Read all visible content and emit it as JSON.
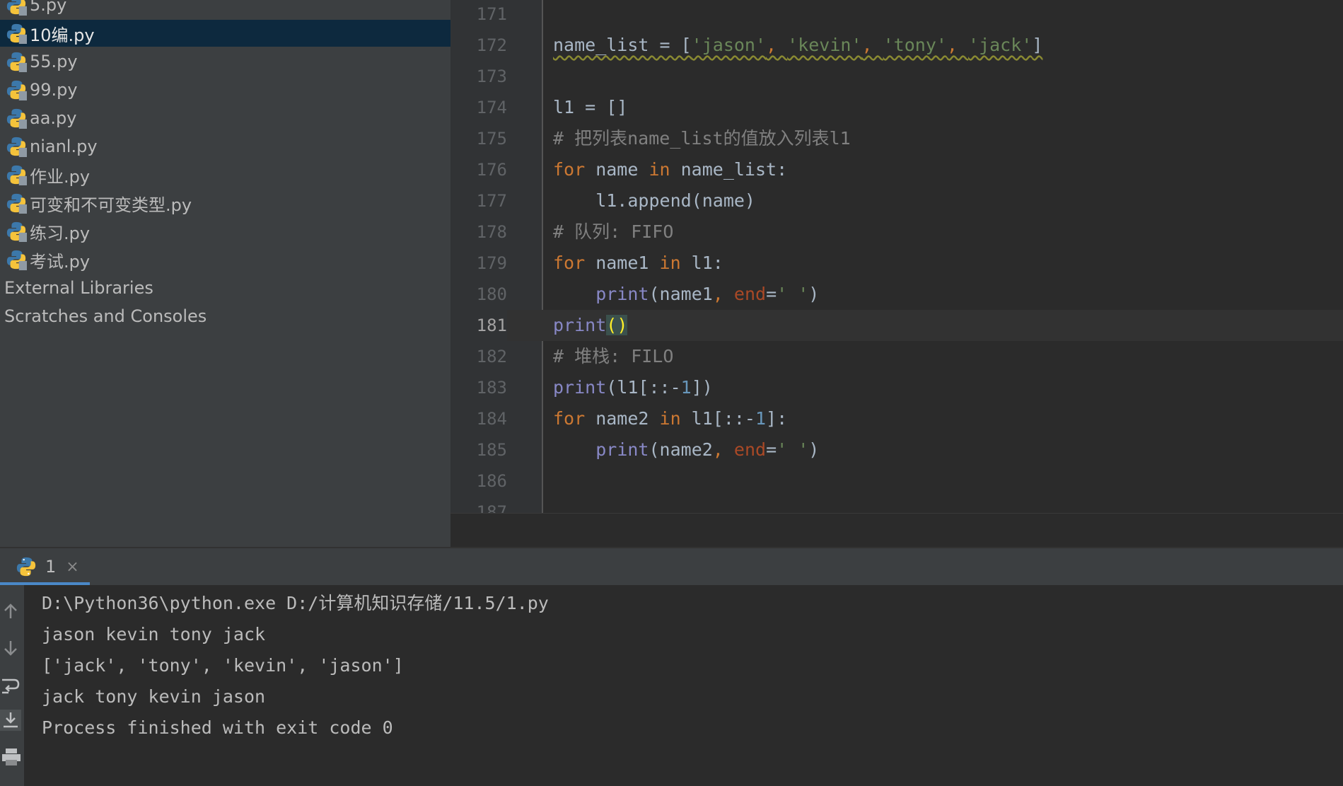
{
  "project_tree": {
    "files": [
      {
        "name": "5.py"
      },
      {
        "name": "10编.py",
        "selected": true
      },
      {
        "name": "55.py"
      },
      {
        "name": "99.py"
      },
      {
        "name": "aa.py"
      },
      {
        "name": "nianl.py"
      },
      {
        "name": "作业.py"
      },
      {
        "name": "可变和不可变类型.py"
      },
      {
        "name": "练习.py"
      },
      {
        "name": "考试.py"
      }
    ],
    "groups": [
      {
        "name": "External Libraries"
      },
      {
        "name": "Scratches and Consoles"
      }
    ]
  },
  "editor": {
    "current_line": "181",
    "lines": [
      {
        "num": "171",
        "tokens": []
      },
      {
        "num": "172",
        "tokens": [
          {
            "t": "name_list = [",
            "c": "ident"
          },
          {
            "t": "'jason'",
            "c": "str"
          },
          {
            "t": ", ",
            "c": "punct"
          },
          {
            "t": "'kevin'",
            "c": "str"
          },
          {
            "t": ", ",
            "c": "punct"
          },
          {
            "t": "'tony'",
            "c": "str"
          },
          {
            "t": ", ",
            "c": "punct"
          },
          {
            "t": "'jack'",
            "c": "str"
          },
          {
            "t": "]",
            "c": "ident"
          }
        ],
        "squiggle": true
      },
      {
        "num": "173",
        "tokens": []
      },
      {
        "num": "174",
        "tokens": [
          {
            "t": "l1 = []",
            "c": "ident"
          }
        ]
      },
      {
        "num": "175",
        "tokens": [
          {
            "t": "# 把列表name_list的值放入列表l1",
            "c": "comment"
          }
        ]
      },
      {
        "num": "176",
        "tokens": [
          {
            "t": "for",
            "c": "kw"
          },
          {
            "t": " name ",
            "c": "ident"
          },
          {
            "t": "in",
            "c": "kw"
          },
          {
            "t": " name_list:",
            "c": "ident"
          }
        ]
      },
      {
        "num": "177",
        "tokens": [
          {
            "t": "    l1.append(name)",
            "c": "ident"
          }
        ]
      },
      {
        "num": "178",
        "tokens": [
          {
            "t": "# 队列: FIFO",
            "c": "comment"
          }
        ]
      },
      {
        "num": "179",
        "tokens": [
          {
            "t": "for",
            "c": "kw"
          },
          {
            "t": " name1 ",
            "c": "ident"
          },
          {
            "t": "in",
            "c": "kw"
          },
          {
            "t": " l1:",
            "c": "ident"
          }
        ]
      },
      {
        "num": "180",
        "tokens": [
          {
            "t": "    ",
            "c": "ident"
          },
          {
            "t": "print",
            "c": "bi"
          },
          {
            "t": "(name1",
            "c": "ident"
          },
          {
            "t": ", ",
            "c": "punct"
          },
          {
            "t": "end",
            "c": "param"
          },
          {
            "t": "=",
            "c": "ident"
          },
          {
            "t": "' '",
            "c": "str"
          },
          {
            "t": ")",
            "c": "ident"
          }
        ]
      },
      {
        "num": "181",
        "tokens": [
          {
            "t": "print",
            "c": "bi"
          },
          {
            "t": "()",
            "c": "matched"
          }
        ]
      },
      {
        "num": "182",
        "tokens": [
          {
            "t": "# 堆栈: FILO",
            "c": "comment"
          }
        ]
      },
      {
        "num": "183",
        "tokens": [
          {
            "t": "print",
            "c": "bi"
          },
          {
            "t": "(l1[::-",
            "c": "ident"
          },
          {
            "t": "1",
            "c": "num"
          },
          {
            "t": "])",
            "c": "ident"
          }
        ]
      },
      {
        "num": "184",
        "tokens": [
          {
            "t": "for",
            "c": "kw"
          },
          {
            "t": " name2 ",
            "c": "ident"
          },
          {
            "t": "in",
            "c": "kw"
          },
          {
            "t": " l1[::-",
            "c": "ident"
          },
          {
            "t": "1",
            "c": "num"
          },
          {
            "t": "]:",
            "c": "ident"
          }
        ]
      },
      {
        "num": "185",
        "tokens": [
          {
            "t": "    ",
            "c": "ident"
          },
          {
            "t": "print",
            "c": "bi"
          },
          {
            "t": "(name2",
            "c": "ident"
          },
          {
            "t": ", ",
            "c": "punct"
          },
          {
            "t": "end",
            "c": "param"
          },
          {
            "t": "=",
            "c": "ident"
          },
          {
            "t": "' '",
            "c": "str"
          },
          {
            "t": ")",
            "c": "ident"
          }
        ]
      },
      {
        "num": "186",
        "tokens": []
      },
      {
        "num": "187",
        "tokens": []
      }
    ]
  },
  "run_panel": {
    "tab_label": "1",
    "tab_close": "×",
    "toolbar_icons": [
      "arrow-up-icon",
      "arrow-down-icon",
      "soft-wrap-icon",
      "scroll-to-end-icon",
      "print-icon"
    ],
    "console_lines": [
      "D:\\Python36\\python.exe D:/计算机知识存储/11.5/1.py",
      "jason kevin tony jack",
      "['jack', 'tony', 'kevin', 'jason']",
      "jack tony kevin jason",
      "Process finished with exit code 0"
    ]
  }
}
